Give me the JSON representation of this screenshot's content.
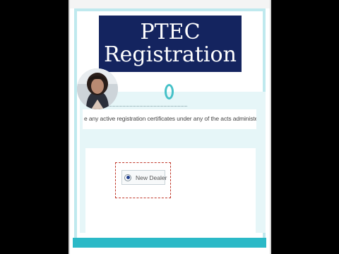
{
  "title": {
    "line1": "PTEC",
    "line2": "Registration"
  },
  "question": {
    "text": "e any active registration certificates under any of the acts administered"
  },
  "radio_option": {
    "label": "New Dealer",
    "selected": true
  },
  "icons": {
    "loading": "loading-ring-icon",
    "avatar": "presenter-avatar"
  },
  "colors": {
    "banner": "#14245f",
    "accent": "#2bb9c7",
    "panel": "#e6f6f8",
    "highlight_border": "#c0392b"
  }
}
